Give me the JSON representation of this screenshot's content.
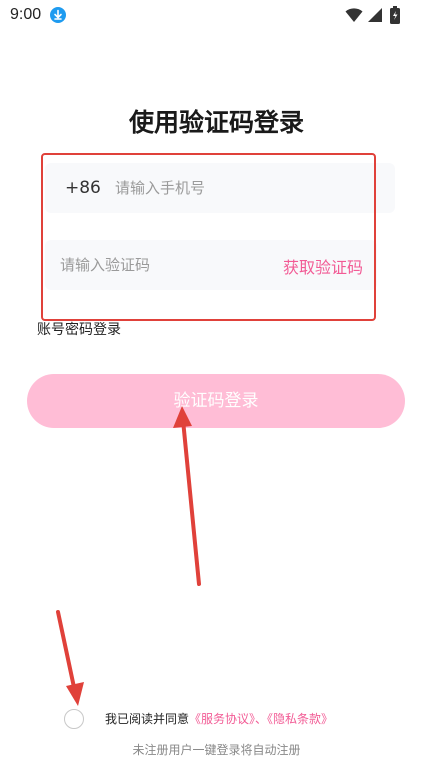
{
  "status_bar": {
    "time": "9:00",
    "icons": [
      "download-icon",
      "wifi-icon",
      "signal-icon",
      "battery-icon"
    ]
  },
  "title": "使用验证码登录",
  "phone": {
    "country_code": "+86",
    "placeholder": "请输入手机号",
    "value": ""
  },
  "code": {
    "placeholder": "请输入验证码",
    "value": "",
    "get_code_label": "获取验证码"
  },
  "password_login_label": "账号密码登录",
  "login_button_label": "验证码登录",
  "agreement": {
    "prefix": "我已阅读并同意",
    "service_link": "《服务协议》",
    "separator": "、",
    "privacy_link": "《隐私条款》",
    "checked": false
  },
  "footer_note": "未注册用户一键登录将自动注册",
  "colors": {
    "accent": "#f25b95",
    "login_button": "#ffbdd6",
    "annotation": "#e0413a",
    "status_download": "#1e9bf0"
  }
}
